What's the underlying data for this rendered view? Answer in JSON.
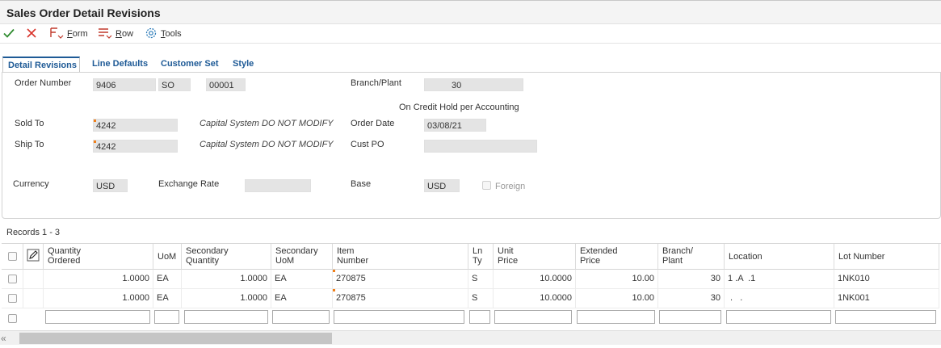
{
  "window": {
    "title": "Sales Order Detail Revisions"
  },
  "toolbar": {
    "ok_icon": "checkmark-icon",
    "cancel_icon": "x-icon",
    "form_prefix": "",
    "form_underline": "F",
    "form_rest": "orm",
    "row_prefix": "",
    "row_underline": "R",
    "row_rest": "ow",
    "tools_prefix": "",
    "tools_underline": "T",
    "tools_rest": "ools",
    "colors": {
      "ok": "#2e8b2e",
      "cancel": "#d9342b",
      "icon": "#c0392b",
      "tools": "#2a7ab8"
    }
  },
  "tabs": [
    {
      "label": "Detail Revisions",
      "active": true
    },
    {
      "label": "Line Defaults"
    },
    {
      "label": "Customer Set"
    },
    {
      "label": "Style"
    }
  ],
  "header": {
    "order_number_label": "Order Number",
    "order_number": "9406",
    "order_type": "SO",
    "order_company": "00001",
    "branch_plant_label": "Branch/Plant",
    "branch_plant": "30",
    "credit_hold_text": "On Credit Hold per Accounting",
    "sold_to_label": "Sold To",
    "sold_to": "4242",
    "sold_to_desc": "Capital System DO NOT MODIFY",
    "order_date_label": "Order Date",
    "order_date": "03/08/21",
    "ship_to_label": "Ship To",
    "ship_to": "4242",
    "ship_to_desc": "Capital System DO NOT MODIFY",
    "cust_po_label": "Cust PO",
    "cust_po": "",
    "currency_label": "Currency",
    "currency": "USD",
    "exchange_rate_label": "Exchange Rate",
    "exchange_rate": "",
    "base_label": "Base",
    "base": "USD",
    "foreign_label": "Foreign"
  },
  "grid": {
    "records_label": "Records 1 - 3",
    "columns": {
      "qty_line1": "Quantity",
      "qty_line2": "Ordered",
      "uom": "UoM",
      "secqty_line1": "Secondary",
      "secqty_line2": "Quantity",
      "secuom_line1": "Secondary",
      "secuom_line2": "UoM",
      "item_line1": "Item",
      "item_line2": "Number",
      "ln_line1": "Ln",
      "ln_line2": "Ty",
      "price_line1": "Unit",
      "price_line2": "Price",
      "ext_line1": "Extended",
      "ext_line2": "Price",
      "branch_line1": "Branch/",
      "branch_line2": "Plant",
      "location": "Location",
      "lot": "Lot Number"
    },
    "rows": [
      {
        "qty": "1.0000",
        "uom": "EA",
        "secqty": "1.0000",
        "secuom": "EA",
        "item": "270875",
        "ln": "S",
        "price": "10.0000",
        "ext": "10.00",
        "branch": "30",
        "location": "1 .A  .1",
        "lot": "1NK010"
      },
      {
        "qty": "1.0000",
        "uom": "EA",
        "secqty": "1.0000",
        "secuom": "EA",
        "item": "270875",
        "ln": "S",
        "price": "10.0000",
        "ext": "10.00",
        "branch": "30",
        "location": " .   .",
        "lot": "1NK001"
      }
    ],
    "edit_icon": "pencil-edit-icon"
  },
  "scrollbar": {
    "left_icon": "double-chevron-left-icon",
    "arrow_glyph": "«"
  }
}
